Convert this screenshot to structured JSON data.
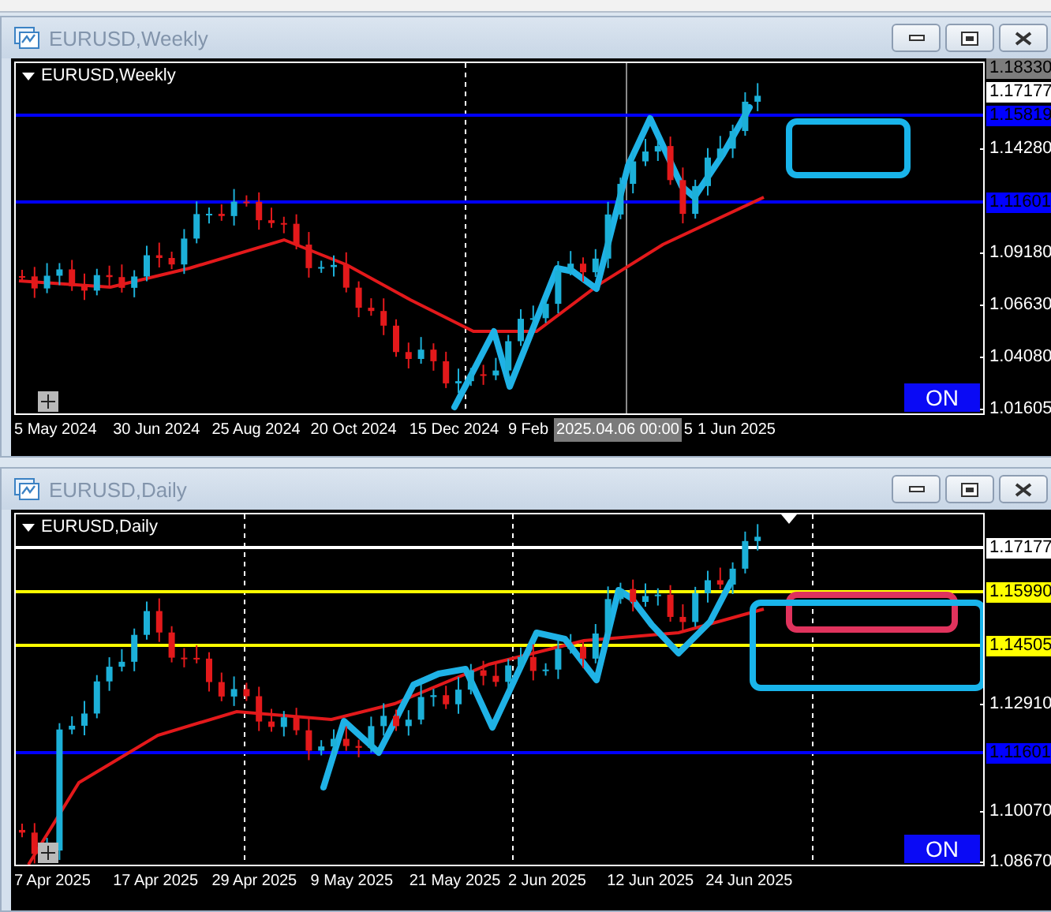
{
  "windows": [
    {
      "title": "EURUSD,Weekly",
      "chart": {
        "symbol": "EURUSD,Weekly",
        "badge": "ON",
        "price_labels": [
          {
            "text": "1.18330",
            "kind": "top"
          },
          {
            "text": "1.17177",
            "kind": "current"
          },
          {
            "text": "1.15819",
            "kind": "line",
            "color": "#0000ff"
          },
          {
            "text": "1.14280",
            "kind": "tick"
          },
          {
            "text": "1.11601",
            "kind": "line",
            "color": "#0000ff"
          },
          {
            "text": "1.09180",
            "kind": "tick"
          },
          {
            "text": "1.06630",
            "kind": "tick"
          },
          {
            "text": "1.04080",
            "kind": "tick"
          },
          {
            "text": "1.01605",
            "kind": "tick"
          }
        ],
        "time_labels": [
          {
            "text": "5 May 2024",
            "kind": "tick"
          },
          {
            "text": "30 Jun 2024",
            "kind": "tick"
          },
          {
            "text": "25 Aug 2024",
            "kind": "tick"
          },
          {
            "text": "20 Oct 2024",
            "kind": "tick"
          },
          {
            "text": "15 Dec 2024",
            "kind": "tick"
          },
          {
            "text": "9 Feb",
            "kind": "partial"
          },
          {
            "text": "2025.04.06 00:00",
            "kind": "crosshair"
          },
          {
            "text": "5",
            "kind": "partial"
          },
          {
            "text": "1 Jun 2025",
            "kind": "tick"
          }
        ]
      }
    },
    {
      "title": "EURUSD,Daily",
      "chart": {
        "symbol": "EURUSD,Daily",
        "badge": "ON",
        "price_labels": [
          {
            "text": "1.17177",
            "kind": "line",
            "color": "#ffffff"
          },
          {
            "text": "1.15990",
            "kind": "line",
            "color": "#ffff00"
          },
          {
            "text": "1.14505",
            "kind": "line",
            "color": "#ffff00"
          },
          {
            "text": "1.12910",
            "kind": "tick"
          },
          {
            "text": "1.11601",
            "kind": "line",
            "color": "#0000ff"
          },
          {
            "text": "1.10070",
            "kind": "tick"
          },
          {
            "text": "1.08670",
            "kind": "tick"
          }
        ],
        "time_labels": [
          {
            "text": "7 Apr 2025",
            "kind": "tick"
          },
          {
            "text": "17 Apr 2025",
            "kind": "tick"
          },
          {
            "text": "29 Apr 2025",
            "kind": "tick"
          },
          {
            "text": "9 May 2025",
            "kind": "tick"
          },
          {
            "text": "21 May 2025",
            "kind": "tick"
          },
          {
            "text": "2 Jun 2025",
            "kind": "tick"
          },
          {
            "text": "12 Jun 2025",
            "kind": "tick"
          },
          {
            "text": "24 Jun 2025",
            "kind": "tick"
          }
        ]
      }
    }
  ]
}
